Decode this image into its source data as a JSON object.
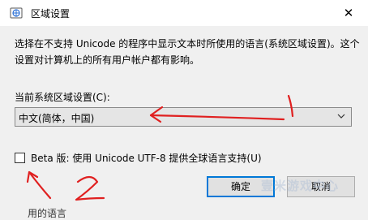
{
  "window": {
    "title": "区域设置",
    "close_glyph": "✕",
    "icon": "globe-icon"
  },
  "description": "选择在不支持 Unicode 的程序中显示文本时所使用的语言(系统区域设置)。这个设置对计算机上的所有用户帐户都有影响。",
  "system_locale": {
    "label": "当前系统区域设置(C):",
    "value": "中文(简体，中国)"
  },
  "beta": {
    "label": "Beta 版: 使用 Unicode UTF-8 提供全球语言支持(U)",
    "checked": false
  },
  "buttons": {
    "ok": "确定",
    "cancel": "取消"
  },
  "background_partial_text": "用的语言",
  "annotations": {
    "mark1": "1",
    "mark2": "2",
    "color": "#e02020"
  },
  "watermark": "壹米游戏中心"
}
